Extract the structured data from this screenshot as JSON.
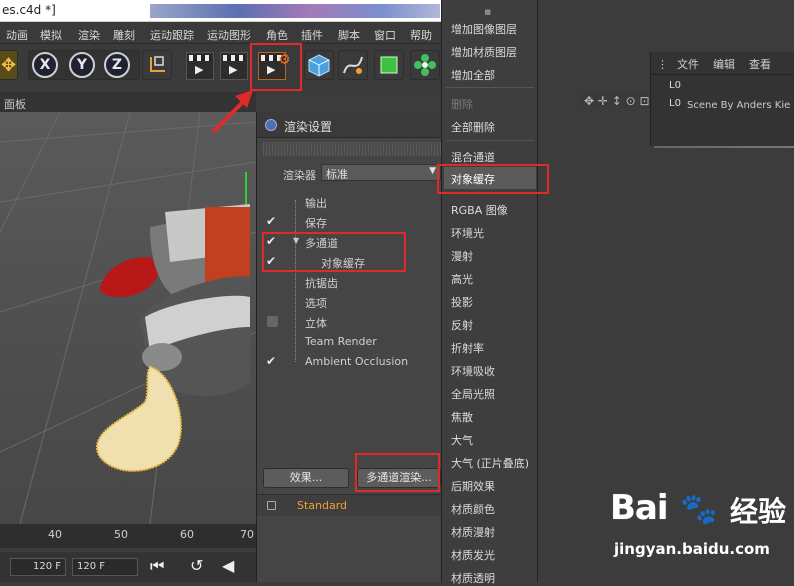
{
  "window": {
    "title": "es.c4d *]"
  },
  "menubar": [
    "动画",
    "模拟",
    "渲染",
    "雕刻",
    "运动跟踪",
    "运动图形",
    "角色",
    "插件",
    "脚本",
    "窗口",
    "帮助"
  ],
  "toolbar": {
    "axes": [
      "X",
      "Y",
      "Z"
    ]
  },
  "viewport": {
    "panel_label": "面板"
  },
  "object_panel": {
    "menu": [
      "文件",
      "编辑",
      "查看"
    ],
    "scene_item": "Scene By Anders Kie"
  },
  "timeline": {
    "ticks": [
      "40",
      "50",
      "60",
      "70"
    ],
    "start_field": "120 F",
    "end_field": "120 F"
  },
  "dialog": {
    "title": "渲染设置",
    "renderer_label": "渲染器",
    "renderer_value": "标准",
    "tree": [
      {
        "label": "输出",
        "check": "none"
      },
      {
        "label": "保存",
        "check": "checked"
      },
      {
        "label": "多通道",
        "check": "checked"
      },
      {
        "label": "对象缓存",
        "check": "checked"
      },
      {
        "label": "抗锯齿",
        "check": "none"
      },
      {
        "label": "选项",
        "check": "none"
      },
      {
        "label": "立体",
        "check": "box"
      },
      {
        "label": "Team Render",
        "check": "none"
      },
      {
        "label": "Ambient Occlusion",
        "check": "checked"
      }
    ],
    "effects_button": "效果...",
    "multipass_button": "多通道渲染...",
    "standard_label": "Standard"
  },
  "menu": {
    "items": [
      {
        "label": "增加图像图层",
        "state": "normal"
      },
      {
        "label": "增加材质图层",
        "state": "normal"
      },
      {
        "label": "增加全部",
        "state": "normal"
      },
      {
        "label": "删除",
        "state": "dim"
      },
      {
        "label": "全部删除",
        "state": "normal"
      },
      {
        "label": "混合通道",
        "state": "normal"
      },
      {
        "label": "对象缓存",
        "state": "highlight"
      },
      {
        "label": "RGBA 图像",
        "state": "normal"
      },
      {
        "label": "环境光",
        "state": "normal"
      },
      {
        "label": "漫射",
        "state": "normal"
      },
      {
        "label": "高光",
        "state": "normal"
      },
      {
        "label": "投影",
        "state": "normal"
      },
      {
        "label": "反射",
        "state": "normal"
      },
      {
        "label": "折射率",
        "state": "normal"
      },
      {
        "label": "环境吸收",
        "state": "normal"
      },
      {
        "label": "全局光照",
        "state": "normal"
      },
      {
        "label": "焦散",
        "state": "normal"
      },
      {
        "label": "大气",
        "state": "normal"
      },
      {
        "label": "大气 (正片叠底)",
        "state": "normal"
      },
      {
        "label": "后期效果",
        "state": "normal"
      },
      {
        "label": "材质颜色",
        "state": "normal"
      },
      {
        "label": "材质漫射",
        "state": "normal"
      },
      {
        "label": "材质发光",
        "state": "normal"
      },
      {
        "label": "材质透明",
        "state": "normal"
      }
    ]
  },
  "watermark": {
    "brand": "Bai",
    "brand_cn": "经验",
    "url": "jingyan.baidu.com"
  },
  "colors": {
    "accent": "#e02a2a",
    "standard": "#f0a030"
  }
}
